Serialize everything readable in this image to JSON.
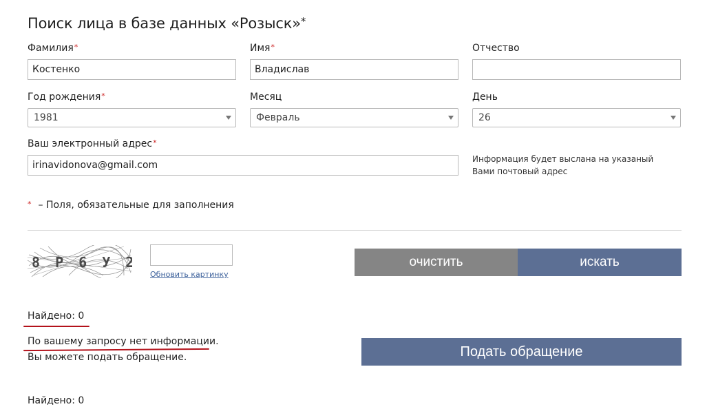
{
  "page": {
    "title": "Поиск лица в базе данных «Розыск»",
    "title_star": "*"
  },
  "form": {
    "surname": {
      "label": "Фамилия",
      "required_mark": "*",
      "value": "Костенко"
    },
    "name": {
      "label": "Имя",
      "required_mark": "*",
      "value": "Владислав"
    },
    "patronymic": {
      "label": "Отчество",
      "value": ""
    },
    "birth_year": {
      "label": "Год рождения",
      "required_mark": "*",
      "value": "1981"
    },
    "month": {
      "label": "Месяц",
      "value": "Февраль"
    },
    "day": {
      "label": "День",
      "value": "26"
    },
    "email": {
      "label": "Ваш электронный адрес",
      "required_mark": "*",
      "value": "irinavidonova@gmail.com"
    },
    "email_hint": "Информация будет выслана на указаный Вами почтовый адрес",
    "required_note_mark": "*",
    "required_note": "– Поля, обязательные для заполнения"
  },
  "captcha": {
    "text": "8 P 6 У 2",
    "refresh_label": "Обновить картинку",
    "input_value": ""
  },
  "buttons": {
    "clear": "очистить",
    "search": "искать",
    "appeal": "Подать обращение"
  },
  "results": {
    "found_top": "Найдено: 0",
    "no_info": "По вашему запросу нет информации.",
    "can_appeal": "Вы можете подать обращение.",
    "found_bottom": "Найдено: 0"
  },
  "colors": {
    "accent_blue": "#5c6f94",
    "clear_gray": "#858585",
    "required_red": "#cc2222",
    "highlight_underline": "#b3121b"
  }
}
